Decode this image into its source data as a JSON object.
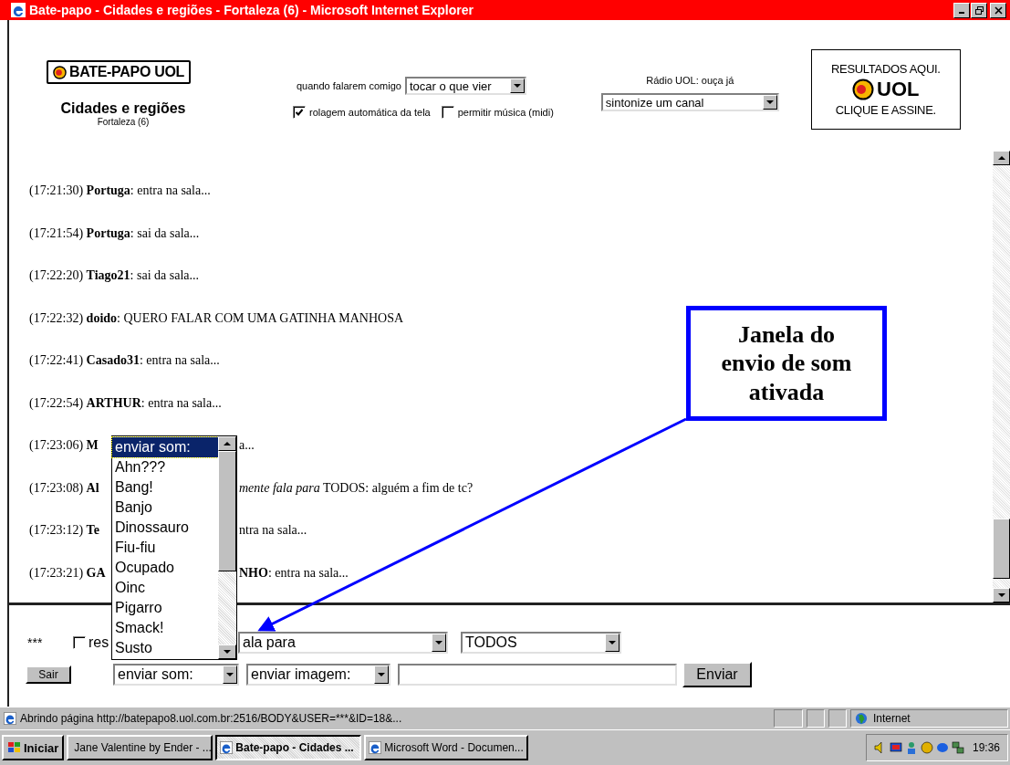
{
  "window": {
    "title": "Bate-papo - Cidades e regiões - Fortaleza (6) - Microsoft Internet Explorer"
  },
  "header": {
    "logo": "BATE-PAPO UOL",
    "room": "Cidades e regiões",
    "room_sub": "Fortaleza (6)",
    "notify_label": "quando falarem comigo",
    "notify_select": "tocar o que vier",
    "options": [
      {
        "label": "rolagem automática da tela",
        "checked": true
      },
      {
        "label": "permitir música (midi)",
        "checked": false
      }
    ],
    "radio_label": "Rádio UOL: ouça já",
    "radio_select": "sintonize um canal",
    "ad": {
      "top": "RESULTADOS AQUI.",
      "logo": "UOL",
      "bottom": "CLIQUE E ASSINE."
    }
  },
  "chat": [
    {
      "left": "(17:21:30) **Portuga**: entra na sala..."
    },
    {
      "left": "(17:21:54) **Portuga**: sai da sala..."
    },
    {
      "left": "(17:22:20) **Tiago21**: sai da sala..."
    },
    {
      "left": "(17:22:32) **doido**: QUERO FALAR COM UMA GATINHA MANHOSA"
    },
    {
      "left": "(17:22:41) **Casado31**: entra na sala..."
    },
    {
      "left": "(17:22:54) **ARTHUR**: entra na sala..."
    },
    {
      "left": "(17:23:06) **M**",
      "right": "a..."
    },
    {
      "left": "(17:23:08) **Al**",
      "right": "*mente fala para* TODOS: alguém a fim de tc?"
    },
    {
      "left": "(17:23:12) **Te**",
      "right": "ntra na sala..."
    },
    {
      "left": "(17:23:21) **GA**",
      "right": "**NHO**: entra na sala..."
    }
  ],
  "form": {
    "prefix": "***",
    "reserved": {
      "label": "res",
      "checked": false
    },
    "verb_select": "ala para",
    "target_select": "TODOS",
    "exit_button": "Sair",
    "sound_select": "enviar som:",
    "image_select": "enviar imagem:",
    "send_button": "Enviar"
  },
  "sound_list": {
    "items": [
      {
        "label": "enviar som:",
        "selected": true
      },
      {
        "label": "Ahn???",
        "selected": false
      },
      {
        "label": "Bang!",
        "selected": false
      },
      {
        "label": "Banjo",
        "selected": false
      },
      {
        "label": "Dinossauro",
        "selected": false
      },
      {
        "label": "Fiu-fiu",
        "selected": false
      },
      {
        "label": "Ocupado",
        "selected": false
      },
      {
        "label": "Oinc",
        "selected": false
      },
      {
        "label": "Pigarro",
        "selected": false
      },
      {
        "label": "Smack!",
        "selected": false
      },
      {
        "label": "Susto",
        "selected": false
      }
    ]
  },
  "callout": {
    "text": "Janela do envio de som ativada"
  },
  "status_bar": {
    "text": "Abrindo página http://batepapo8.uol.com.br:2516/BODY&USER=***&ID=18&...",
    "zone": "Internet"
  },
  "taskbar": {
    "start": "Iniciar",
    "tasks": [
      {
        "label": "Jane Valentine by Ender - ...",
        "selected": false
      },
      {
        "label": "Bate-papo - Cidades ...",
        "selected": true
      },
      {
        "label": "Microsoft Word - Documen...",
        "selected": false
      }
    ],
    "clock": "19:36"
  }
}
